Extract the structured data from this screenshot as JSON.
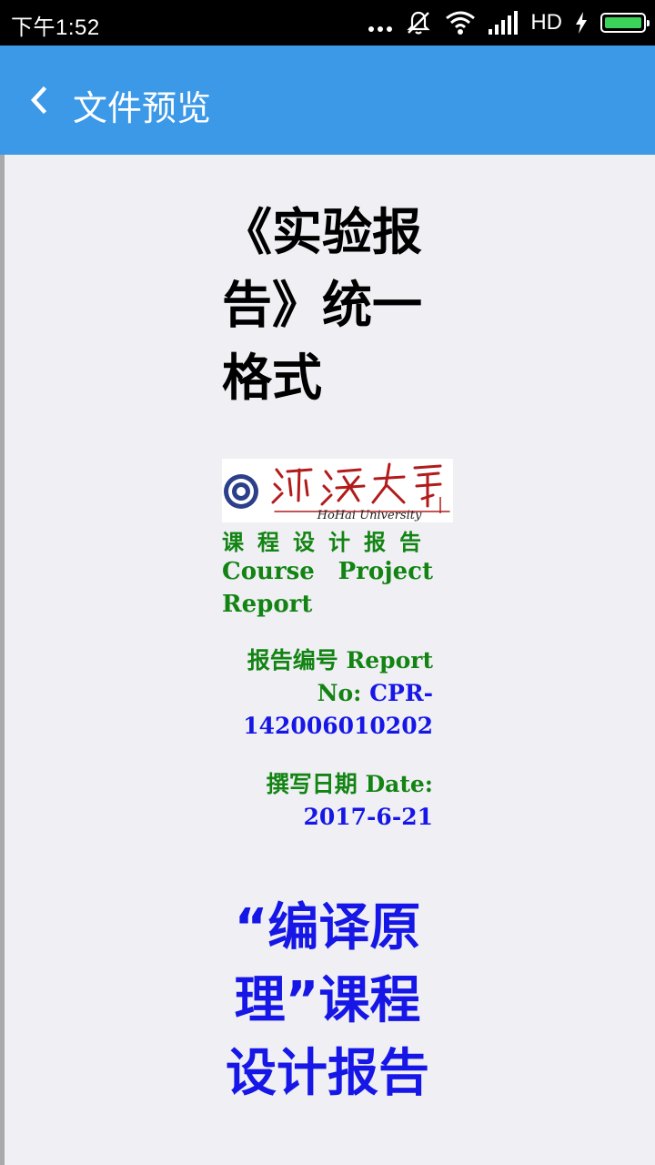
{
  "status_bar": {
    "time": "下午1:52",
    "network": "HD",
    "icons": [
      "more-dots-icon",
      "mute-icon",
      "wifi-icon",
      "signal-icon",
      "charging-icon",
      "battery-icon"
    ],
    "battery_color": "#3bd35a"
  },
  "header": {
    "title": "文件预览",
    "background": "#3b99e8"
  },
  "document": {
    "title_lines": [
      "《实验报",
      "告》统一",
      "格式"
    ],
    "logo_text": "HoHai University",
    "course_cn": "课程设计报告",
    "course_en_line1_a": "Course",
    "course_en_line1_b": "Project",
    "course_en_line2": "Report",
    "report_no_label_cn": "报告编号 Report",
    "report_no_label_en": "No:",
    "report_no_value_a": "CPR-",
    "report_no_value_b": "142006010202",
    "date_label": "撰写日期 Date:",
    "date_value": "2017-6-21",
    "course_name_lines": [
      "“编译原",
      "理”课程",
      "设计报告"
    ],
    "colors": {
      "green": "#138413",
      "blue": "#1616e6"
    }
  }
}
